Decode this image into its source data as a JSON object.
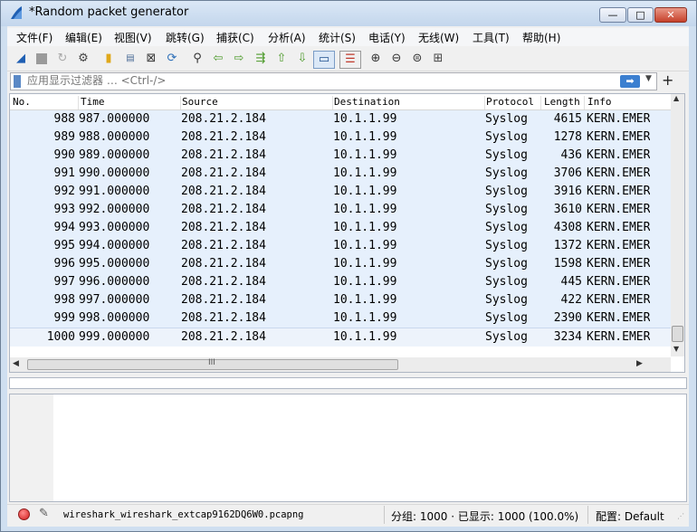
{
  "window": {
    "title": "*Random packet generator",
    "minimize_glyph": "—",
    "maximize_glyph": "□",
    "close_glyph": "✕"
  },
  "menu": [
    "文件(F)",
    "编辑(E)",
    "视图(V)",
    "跳转(G)",
    "捕获(C)",
    "分析(A)",
    "统计(S)",
    "电话(Y)",
    "无线(W)",
    "工具(T)",
    "帮助(H)"
  ],
  "toolbar": {
    "icons": [
      "start-capture-icon",
      "stop-capture-icon",
      "restart-capture-icon",
      "capture-options-icon",
      "open-file-icon",
      "save-file-icon",
      "close-file-icon",
      "reload-file-icon",
      "find-packet-icon",
      "go-back-icon",
      "go-forward-icon",
      "go-to-packet-icon",
      "go-first-icon",
      "go-last-icon",
      "auto-scroll-icon",
      "colorize-icon",
      "zoom-in-icon",
      "zoom-out-icon",
      "zoom-normal-icon",
      "resize-columns-icon"
    ]
  },
  "filter": {
    "placeholder": "应用显示过滤器 … <Ctrl-/>",
    "apply_glyph": "➡",
    "dropdown_glyph": "▼",
    "add_glyph": "+"
  },
  "packet_list": {
    "columns": [
      "No.",
      "Time",
      "Source",
      "Destination",
      "Protocol",
      "Length",
      "Info"
    ],
    "rows": [
      {
        "no": "988",
        "time": "987.000000",
        "source": "208.21.2.184",
        "destination": "10.1.1.99",
        "protocol": "Syslog",
        "length": "4615",
        "info": "KERN.EMER"
      },
      {
        "no": "989",
        "time": "988.000000",
        "source": "208.21.2.184",
        "destination": "10.1.1.99",
        "protocol": "Syslog",
        "length": "1278",
        "info": "KERN.EMER"
      },
      {
        "no": "990",
        "time": "989.000000",
        "source": "208.21.2.184",
        "destination": "10.1.1.99",
        "protocol": "Syslog",
        "length": "436",
        "info": "KERN.EMER"
      },
      {
        "no": "991",
        "time": "990.000000",
        "source": "208.21.2.184",
        "destination": "10.1.1.99",
        "protocol": "Syslog",
        "length": "3706",
        "info": "KERN.EMER"
      },
      {
        "no": "992",
        "time": "991.000000",
        "source": "208.21.2.184",
        "destination": "10.1.1.99",
        "protocol": "Syslog",
        "length": "3916",
        "info": "KERN.EMER"
      },
      {
        "no": "993",
        "time": "992.000000",
        "source": "208.21.2.184",
        "destination": "10.1.1.99",
        "protocol": "Syslog",
        "length": "3610",
        "info": "KERN.EMER"
      },
      {
        "no": "994",
        "time": "993.000000",
        "source": "208.21.2.184",
        "destination": "10.1.1.99",
        "protocol": "Syslog",
        "length": "4308",
        "info": "KERN.EMER"
      },
      {
        "no": "995",
        "time": "994.000000",
        "source": "208.21.2.184",
        "destination": "10.1.1.99",
        "protocol": "Syslog",
        "length": "1372",
        "info": "KERN.EMER"
      },
      {
        "no": "996",
        "time": "995.000000",
        "source": "208.21.2.184",
        "destination": "10.1.1.99",
        "protocol": "Syslog",
        "length": "1598",
        "info": "KERN.EMER"
      },
      {
        "no": "997",
        "time": "996.000000",
        "source": "208.21.2.184",
        "destination": "10.1.1.99",
        "protocol": "Syslog",
        "length": "445",
        "info": "KERN.EMER"
      },
      {
        "no": "998",
        "time": "997.000000",
        "source": "208.21.2.184",
        "destination": "10.1.1.99",
        "protocol": "Syslog",
        "length": "422",
        "info": "KERN.EMER"
      },
      {
        "no": "999",
        "time": "998.000000",
        "source": "208.21.2.184",
        "destination": "10.1.1.99",
        "protocol": "Syslog",
        "length": "2390",
        "info": "KERN.EMER"
      },
      {
        "no": "1000",
        "time": "999.000000",
        "source": "208.21.2.184",
        "destination": "10.1.1.99",
        "protocol": "Syslog",
        "length": "3234",
        "info": "KERN.EMER"
      }
    ],
    "selected_row": "1000",
    "row_color": "#e6f0fc"
  },
  "scrollbars": {
    "up_glyph": "▲",
    "down_glyph": "▼",
    "left_glyph": "◀",
    "right_glyph": "▶",
    "grip_glyph": "III"
  },
  "status": {
    "file": "wireshark_wireshark_extcap9162DQ6W0.pcapng",
    "stats": "分组: 1000 · 已显示: 1000 (100.0%)",
    "profile": "配置: Default",
    "led_color": "#d21b1b"
  }
}
